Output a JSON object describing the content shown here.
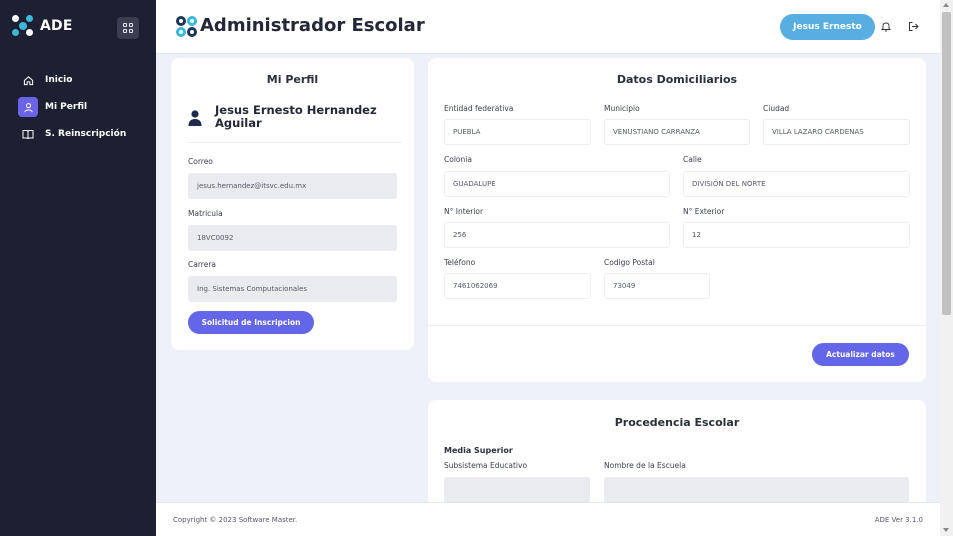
{
  "brand": {
    "name": "ADE"
  },
  "sidebar": {
    "items": [
      {
        "label": "Inicio",
        "icon": "home-icon"
      },
      {
        "label": "Mi Perfil",
        "icon": "user-icon"
      },
      {
        "label": "S. Reinscripción",
        "icon": "book-icon"
      }
    ]
  },
  "header": {
    "title": "Administrador Escolar",
    "user": "Jesus Ernesto"
  },
  "profile": {
    "title": "Mi Perfil",
    "name": "Jesus Ernesto Hernandez Aguilar",
    "email_label": "Correo",
    "email": "jesus.hernandez@itsvc.edu.mx",
    "matricula_label": "Matricula",
    "matricula": "18VC0092",
    "carrera_label": "Carrera",
    "carrera": "Ing. Sistemas Computacionales",
    "button": "Solicitud de Inscripcion"
  },
  "domicilio": {
    "title": "Datos Domiciliarios",
    "entidad_label": "Entidad federativa",
    "entidad": "PUEBLA",
    "municipio_label": "Municipio",
    "municipio": "VENUSTIANO CARRANZA",
    "ciudad_label": "Ciudad",
    "ciudad": "VILLA LAZARO CARDENAS",
    "colonia_label": "Colonia",
    "colonia": "GUADALUPE",
    "calle_label": "Calle",
    "calle": "DIVISIÓN DEL NORTE",
    "interior_label": "N° Interior",
    "interior": "256",
    "exterior_label": "N° Exterior",
    "exterior": "12",
    "telefono_label": "Teléfono",
    "telefono": "7461062069",
    "cp_label": "Codigo Postal",
    "cp": "73049",
    "button": "Actualizar datos"
  },
  "procedencia": {
    "title": "Procedencia Escolar",
    "section": "Media Superior",
    "subsistema_label": "Subsistema Educativo",
    "escuela_label": "Nombre de la Escuela"
  },
  "footer": {
    "copyright": "Copyright © 2023 Software Master.",
    "version": "ADE Ver 3.1.0"
  }
}
